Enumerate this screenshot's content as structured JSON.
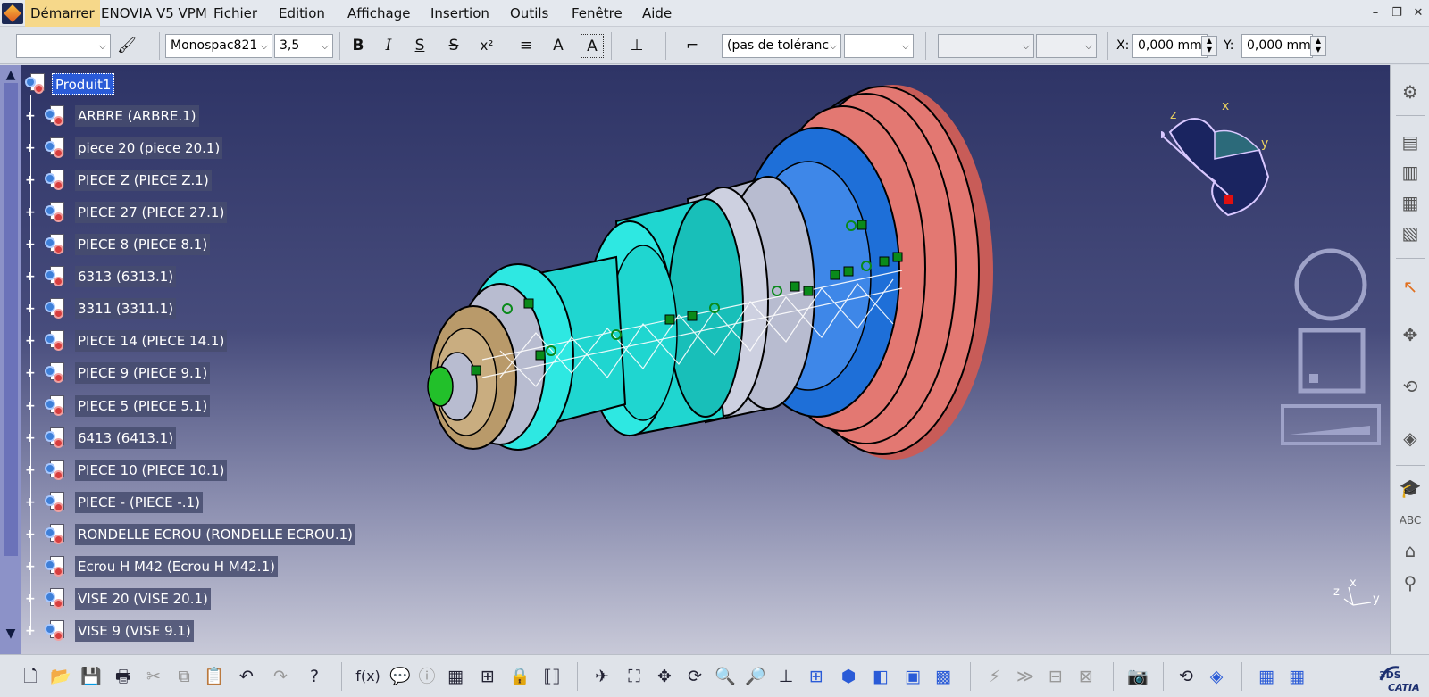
{
  "menubar": {
    "items": [
      "Démarrer",
      "ENOVIA V5 VPM",
      "Fichier",
      "Edition",
      "Affichage",
      "Insertion",
      "Outils",
      "Fenêtre",
      "Aide"
    ],
    "window_controls": [
      "–",
      "❐",
      "✕"
    ]
  },
  "toolbar": {
    "style_combo": "",
    "font_combo": "Monospac821",
    "size_combo": "3,5",
    "bold": "B",
    "italic": "I",
    "underline": "S",
    "strike": "S",
    "superscript": "x²",
    "tolerance_combo": "(pas de toléranc",
    "tolerance_value_combo": "",
    "combo_a": "",
    "combo_b": "",
    "x_label": "X:",
    "x_value": "0,000 mm",
    "y_label": "Y:",
    "y_value": "0,000 mm"
  },
  "tree": {
    "root": "Produit1",
    "items": [
      "ARBRE (ARBRE.1)",
      "piece 20 (piece 20.1)",
      "PIECE Z (PIECE Z.1)",
      "PIECE 27 (PIECE 27.1)",
      "PIECE 8 (PIECE 8.1)",
      "6313 (6313.1)",
      "3311 (3311.1)",
      "PIECE 14 (PIECE 14.1)",
      "PIECE 9 (PIECE 9.1)",
      "PIECE 5 (PIECE 5.1)",
      "6413 (6413.1)",
      "PIECE 10 (PIECE 10.1)",
      "PIECE - (PIECE -.1)",
      "RONDELLE ECROU (RONDELLE ECROU.1)",
      "Ecrou H M42 (Ecrou H M42.1)",
      "VISE 20 (VISE 20.1)",
      "VISE 9 (VISE 9.1)"
    ]
  },
  "compass": {
    "x": "x",
    "y": "y",
    "z": "z"
  },
  "axis_triad": {
    "x": "x",
    "y": "y",
    "z": "z"
  },
  "branding": {
    "logo": "CATIA",
    "ds": "3DS"
  },
  "colors": {
    "pulley_red": "#e37872",
    "bearing_blue": "#1e6fd8",
    "shaft_cyan": "#1fd6d0",
    "spacer_grey": "#b8bcd0",
    "gear_tan": "#b99a6a",
    "selection_blue": "#2a5bd7"
  }
}
